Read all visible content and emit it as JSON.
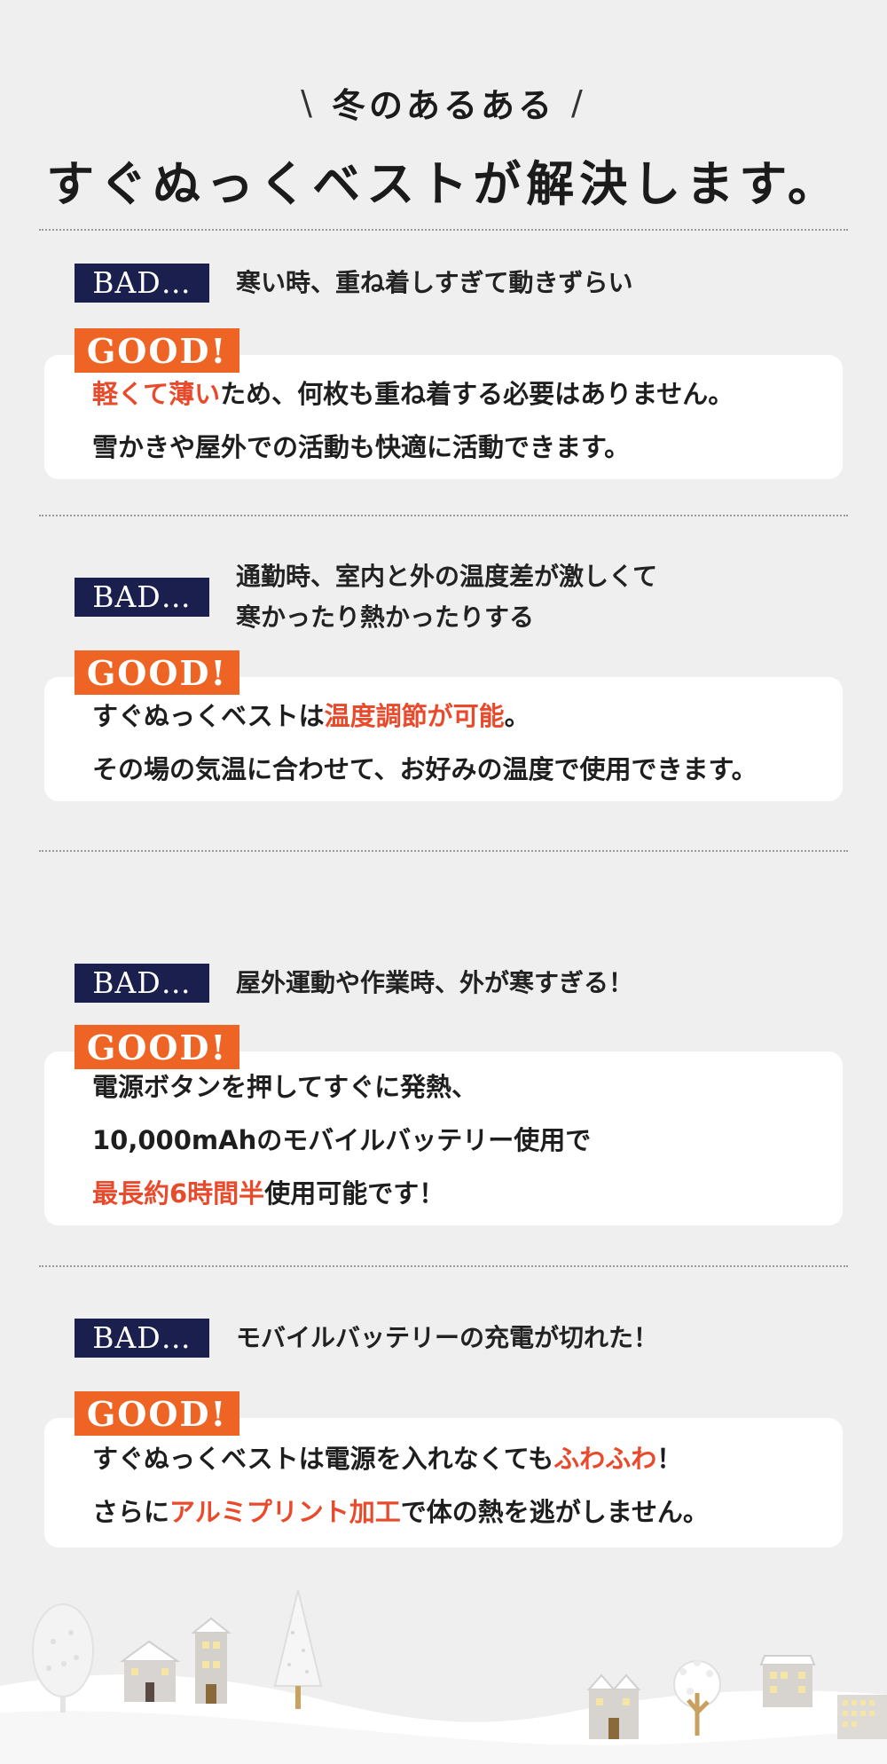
{
  "header": {
    "subtitle": "冬のあるある",
    "slash_left": "\\",
    "slash_right": "/",
    "title": "すぐぬっくベストが解決します。"
  },
  "items": [
    {
      "bad_label": "BAD…",
      "bad_line1": "寒い時、重ね着しすぎて動きずらい",
      "good_label": "GOOD!",
      "line1_hl": "軽くて薄い",
      "line1_rest": "ため、何枚も重ね着する必要はありません。",
      "line2": "雪かきや屋外での活動も快適に活動できます。"
    },
    {
      "bad_label": "BAD…",
      "bad_line1": "通勤時、室内と外の温度差が激しくて",
      "bad_line2": "寒かったり熱かったりする",
      "good_label": "GOOD!",
      "line1_pre": "すぐぬっくベストは",
      "line1_hl": "温度調節が可能",
      "line1_post": "。",
      "line2": "その場の気温に合わせて、お好みの温度で使用できます。"
    },
    {
      "bad_label": "BAD…",
      "bad_line1": "屋外運動や作業時、外が寒すぎる！",
      "good_label": "GOOD!",
      "line1": "電源ボタンを押してすぐに発熱、",
      "line2": "10,000mAhのモバイルバッテリー使用で",
      "line3_hl": "最長約6時間半",
      "line3_rest": "使用可能です！"
    },
    {
      "bad_label": "BAD…",
      "bad_line1": "モバイルバッテリーの充電が切れた！",
      "good_label": "GOOD!",
      "line1_pre": "すぐぬっくベストは電源を入れなくても",
      "line1_hl": "ふわふわ",
      "line1_post": "！",
      "line2_pre": "さらに",
      "line2_hl": "アルミプリント加工",
      "line2_post": "で体の熱を逃がしません。"
    }
  ],
  "colors": {
    "background": "#efeff0",
    "bad_badge": "#1a1f4e",
    "good_badge": "#ee6424",
    "highlight": "#ea4a2c"
  },
  "decoration": {
    "icons": [
      "snowy-tree-icon",
      "house-icon",
      "house-icon",
      "pine-tree-icon",
      "house-icon",
      "round-tree-icon",
      "house-icon",
      "building-icon"
    ]
  }
}
